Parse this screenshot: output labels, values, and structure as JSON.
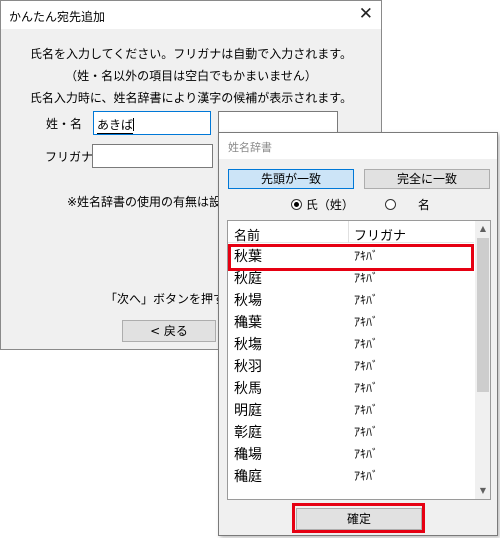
{
  "main_dialog": {
    "title": "かんたん宛先追加",
    "close_icon": "close-icon",
    "instructions": [
      "氏名を入力してください。フリガナは自動で入力されます。",
      "（姓・名以外の項目は空白でもかまいません）",
      "氏名入力時に、姓名辞書により漢字の候補が表示されます。"
    ],
    "surname_label": "姓・名",
    "surname_value": "あきば",
    "furigana_label": "フリガナ",
    "note": "※姓名辞書の使用の有無は設定",
    "next_hint": "「次へ」ボタンを押すと先に",
    "back_button": "< 戻る"
  },
  "popup": {
    "title": "姓名辞書",
    "tab_prefix": "先頭が一致",
    "tab_exact": "完全に一致",
    "radio_surname": "氏（姓）",
    "radio_given": "名",
    "selected_radio": "surname",
    "column_name": "名前",
    "column_furigana": "フリガナ",
    "rows": [
      {
        "name": "秋葉",
        "furigana": "ｱｷﾊﾞ"
      },
      {
        "name": "秋庭",
        "furigana": "ｱｷﾊﾞ"
      },
      {
        "name": "秋場",
        "furigana": "ｱｷﾊﾞ"
      },
      {
        "name": "穐葉",
        "furigana": "ｱｷﾊﾞ"
      },
      {
        "name": "秋塲",
        "furigana": "ｱｷﾊﾞ"
      },
      {
        "name": "秋羽",
        "furigana": "ｱｷﾊﾞ"
      },
      {
        "name": "秋馬",
        "furigana": "ｱｷﾊﾞ"
      },
      {
        "name": "明庭",
        "furigana": "ｱｷﾊﾞ"
      },
      {
        "name": "彰庭",
        "furigana": "ｱｷﾊﾞ"
      },
      {
        "name": "穐場",
        "furigana": "ｱｷﾊﾞ"
      },
      {
        "name": "穐庭",
        "furigana": "ｱｷﾊﾞ"
      }
    ],
    "confirm_button": "確定"
  },
  "colors": {
    "highlight": "#e60012",
    "selected_tab": "#cce4f7",
    "focus_border": "#0078d7"
  }
}
